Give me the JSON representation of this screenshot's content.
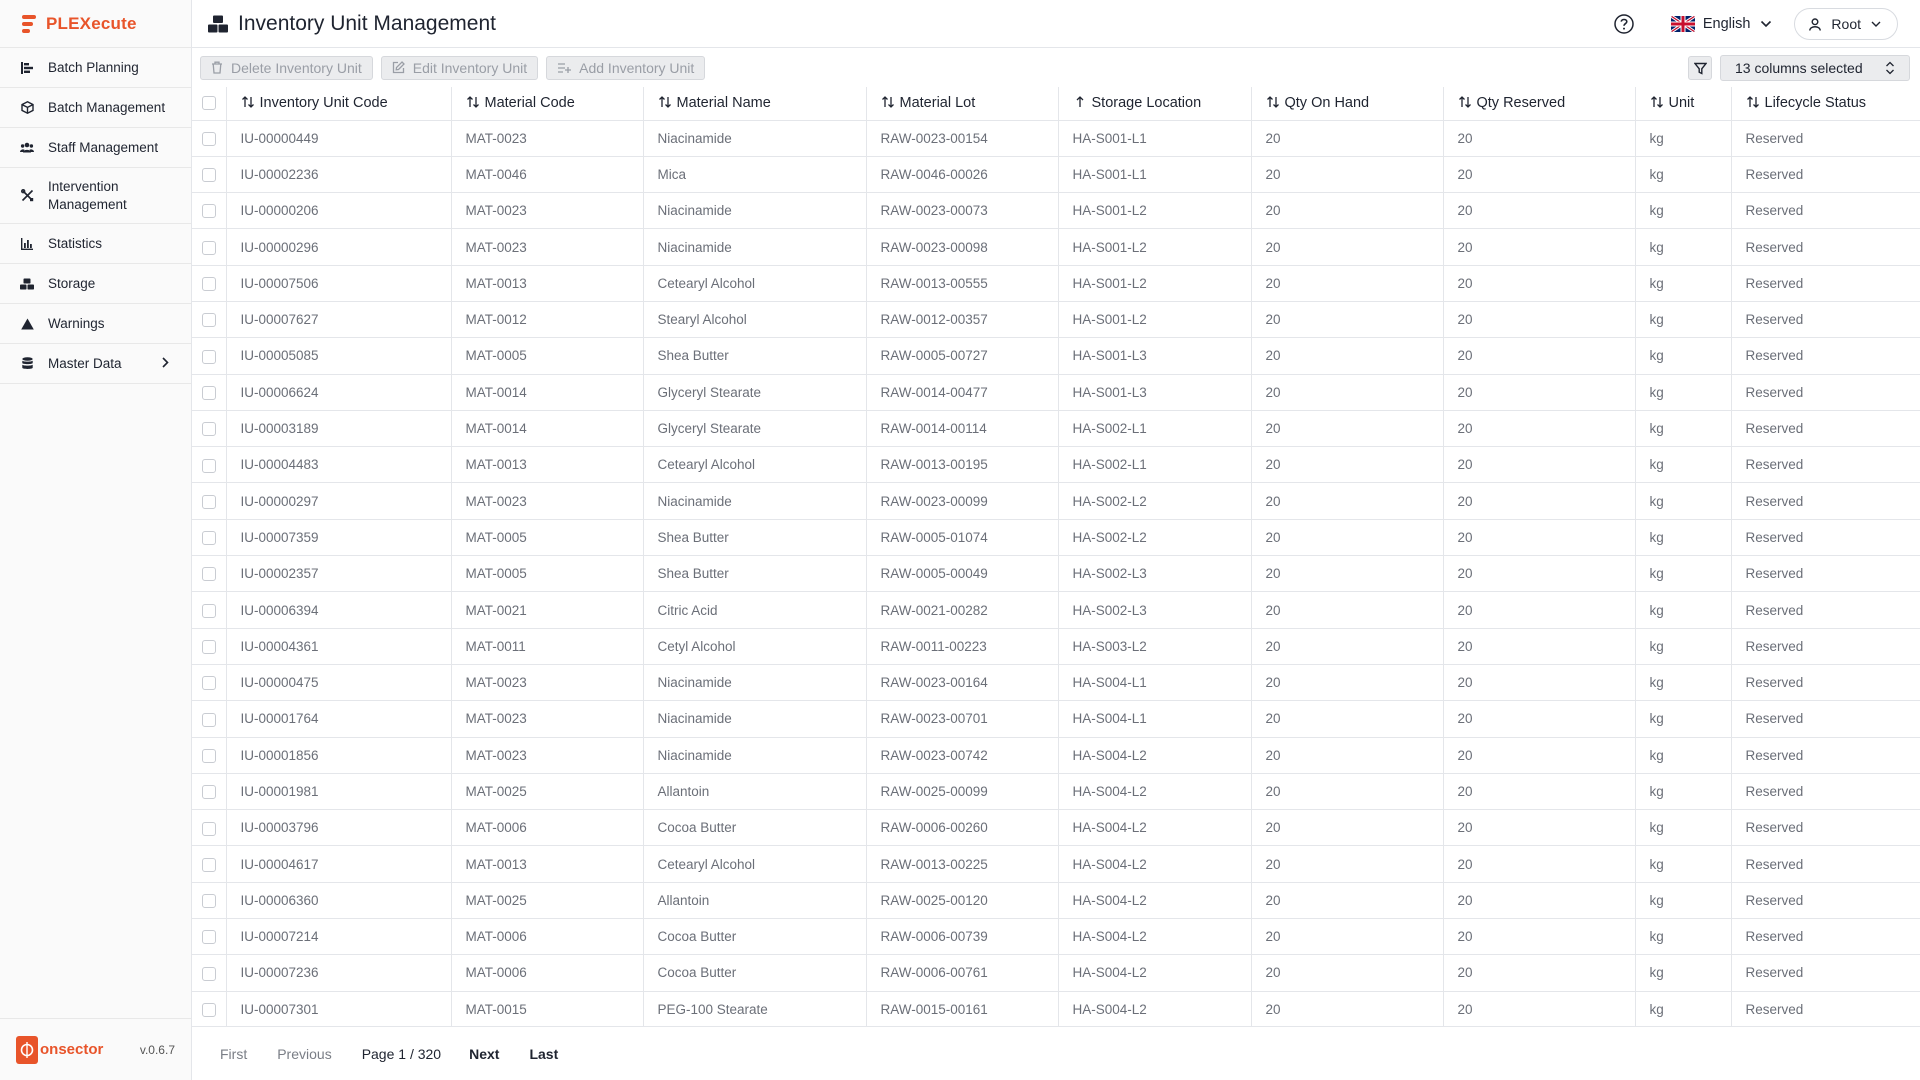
{
  "app": {
    "brand": "PLEXecute",
    "footer_brand": "onsector",
    "version": "v.0.6.7"
  },
  "sidebar": {
    "items": [
      {
        "label": "Batch Planning",
        "icon": "batch-planning-icon"
      },
      {
        "label": "Batch Management",
        "icon": "cube-icon"
      },
      {
        "label": "Staff Management",
        "icon": "users-icon"
      },
      {
        "label": "Intervention Management",
        "icon": "tools-icon"
      },
      {
        "label": "Statistics",
        "icon": "bar-chart-icon"
      },
      {
        "label": "Storage",
        "icon": "boxes-icon"
      },
      {
        "label": "Warnings",
        "icon": "warning-icon"
      },
      {
        "label": "Master Data",
        "icon": "database-icon"
      }
    ]
  },
  "header": {
    "title": "Inventory Unit Management",
    "language": "English",
    "user": "Root"
  },
  "toolbar": {
    "delete_label": "Delete Inventory Unit",
    "edit_label": "Edit Inventory Unit",
    "add_label": "Add Inventory Unit",
    "columns_selected": "13 columns selected"
  },
  "table": {
    "columns": [
      "Inventory Unit Code",
      "Material Code",
      "Material Name",
      "Material Lot",
      "Storage Location",
      "Qty On Hand",
      "Qty Reserved",
      "Unit",
      "Lifecycle Status"
    ],
    "rows": [
      [
        "IU-00000449",
        "MAT-0023",
        "Niacinamide",
        "RAW-0023-00154",
        "HA-S001-L1",
        "20",
        "20",
        "kg",
        "Reserved"
      ],
      [
        "IU-00002236",
        "MAT-0046",
        "Mica",
        "RAW-0046-00026",
        "HA-S001-L1",
        "20",
        "20",
        "kg",
        "Reserved"
      ],
      [
        "IU-00000206",
        "MAT-0023",
        "Niacinamide",
        "RAW-0023-00073",
        "HA-S001-L2",
        "20",
        "20",
        "kg",
        "Reserved"
      ],
      [
        "IU-00000296",
        "MAT-0023",
        "Niacinamide",
        "RAW-0023-00098",
        "HA-S001-L2",
        "20",
        "20",
        "kg",
        "Reserved"
      ],
      [
        "IU-00007506",
        "MAT-0013",
        "Cetearyl Alcohol",
        "RAW-0013-00555",
        "HA-S001-L2",
        "20",
        "20",
        "kg",
        "Reserved"
      ],
      [
        "IU-00007627",
        "MAT-0012",
        "Stearyl Alcohol",
        "RAW-0012-00357",
        "HA-S001-L2",
        "20",
        "20",
        "kg",
        "Reserved"
      ],
      [
        "IU-00005085",
        "MAT-0005",
        "Shea Butter",
        "RAW-0005-00727",
        "HA-S001-L3",
        "20",
        "20",
        "kg",
        "Reserved"
      ],
      [
        "IU-00006624",
        "MAT-0014",
        "Glyceryl Stearate",
        "RAW-0014-00477",
        "HA-S001-L3",
        "20",
        "20",
        "kg",
        "Reserved"
      ],
      [
        "IU-00003189",
        "MAT-0014",
        "Glyceryl Stearate",
        "RAW-0014-00114",
        "HA-S002-L1",
        "20",
        "20",
        "kg",
        "Reserved"
      ],
      [
        "IU-00004483",
        "MAT-0013",
        "Cetearyl Alcohol",
        "RAW-0013-00195",
        "HA-S002-L1",
        "20",
        "20",
        "kg",
        "Reserved"
      ],
      [
        "IU-00000297",
        "MAT-0023",
        "Niacinamide",
        "RAW-0023-00099",
        "HA-S002-L2",
        "20",
        "20",
        "kg",
        "Reserved"
      ],
      [
        "IU-00007359",
        "MAT-0005",
        "Shea Butter",
        "RAW-0005-01074",
        "HA-S002-L2",
        "20",
        "20",
        "kg",
        "Reserved"
      ],
      [
        "IU-00002357",
        "MAT-0005",
        "Shea Butter",
        "RAW-0005-00049",
        "HA-S002-L3",
        "20",
        "20",
        "kg",
        "Reserved"
      ],
      [
        "IU-00006394",
        "MAT-0021",
        "Citric Acid",
        "RAW-0021-00282",
        "HA-S002-L3",
        "20",
        "20",
        "kg",
        "Reserved"
      ],
      [
        "IU-00004361",
        "MAT-0011",
        "Cetyl Alcohol",
        "RAW-0011-00223",
        "HA-S003-L2",
        "20",
        "20",
        "kg",
        "Reserved"
      ],
      [
        "IU-00000475",
        "MAT-0023",
        "Niacinamide",
        "RAW-0023-00164",
        "HA-S004-L1",
        "20",
        "20",
        "kg",
        "Reserved"
      ],
      [
        "IU-00001764",
        "MAT-0023",
        "Niacinamide",
        "RAW-0023-00701",
        "HA-S004-L1",
        "20",
        "20",
        "kg",
        "Reserved"
      ],
      [
        "IU-00001856",
        "MAT-0023",
        "Niacinamide",
        "RAW-0023-00742",
        "HA-S004-L2",
        "20",
        "20",
        "kg",
        "Reserved"
      ],
      [
        "IU-00001981",
        "MAT-0025",
        "Allantoin",
        "RAW-0025-00099",
        "HA-S004-L2",
        "20",
        "20",
        "kg",
        "Reserved"
      ],
      [
        "IU-00003796",
        "MAT-0006",
        "Cocoa Butter",
        "RAW-0006-00260",
        "HA-S004-L2",
        "20",
        "20",
        "kg",
        "Reserved"
      ],
      [
        "IU-00004617",
        "MAT-0013",
        "Cetearyl Alcohol",
        "RAW-0013-00225",
        "HA-S004-L2",
        "20",
        "20",
        "kg",
        "Reserved"
      ],
      [
        "IU-00006360",
        "MAT-0025",
        "Allantoin",
        "RAW-0025-00120",
        "HA-S004-L2",
        "20",
        "20",
        "kg",
        "Reserved"
      ],
      [
        "IU-00007214",
        "MAT-0006",
        "Cocoa Butter",
        "RAW-0006-00739",
        "HA-S004-L2",
        "20",
        "20",
        "kg",
        "Reserved"
      ],
      [
        "IU-00007236",
        "MAT-0006",
        "Cocoa Butter",
        "RAW-0006-00761",
        "HA-S004-L2",
        "20",
        "20",
        "kg",
        "Reserved"
      ],
      [
        "IU-00007301",
        "MAT-0015",
        "PEG-100 Stearate",
        "RAW-0015-00161",
        "HA-S004-L2",
        "20",
        "20",
        "kg",
        "Reserved"
      ]
    ]
  },
  "pagination": {
    "first": "First",
    "previous": "Previous",
    "page_info": "Page 1 / 320",
    "next": "Next",
    "last": "Last"
  },
  "colors": {
    "accent": "#e8542a",
    "border": "#e4e6ea",
    "muted_text": "#6b6f78"
  }
}
